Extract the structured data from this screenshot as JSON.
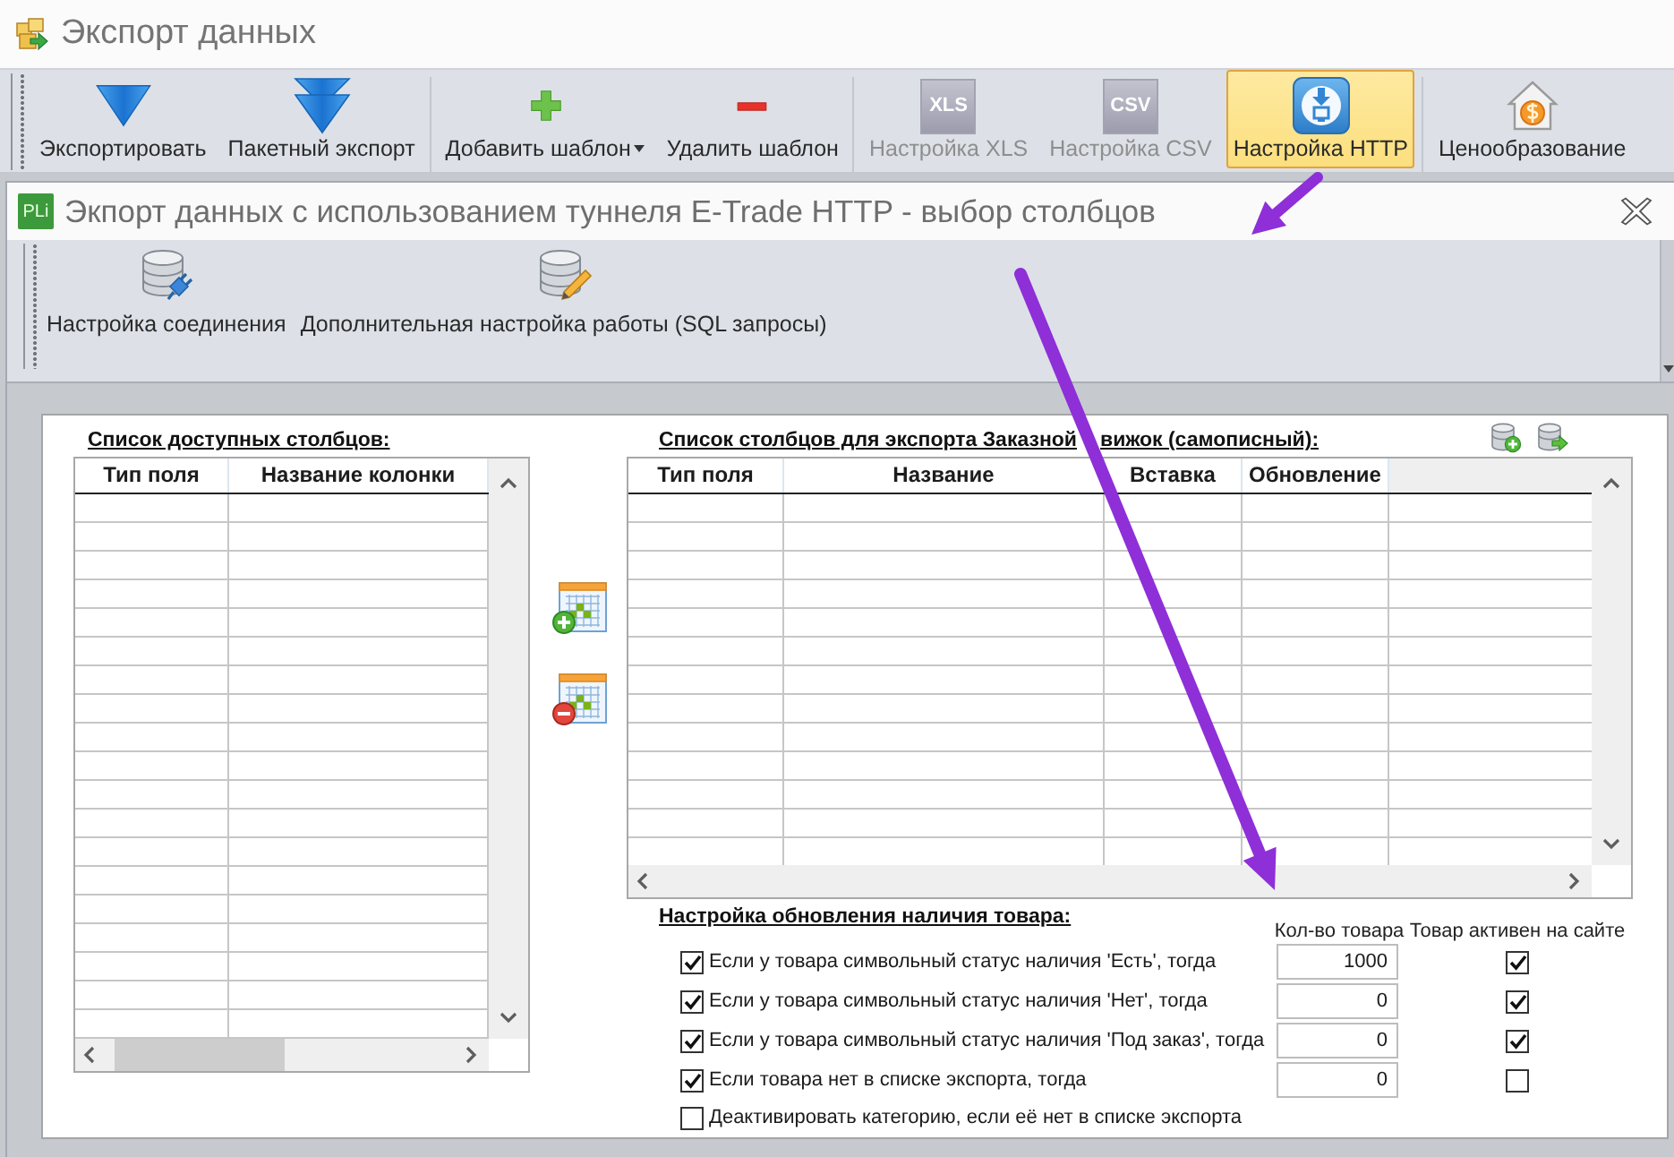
{
  "app": {
    "title": "Экспорт данных"
  },
  "ribbon": {
    "groups": [
      {
        "buttons": [
          {
            "label": "Экспортировать",
            "kind": "export",
            "selected": false,
            "disabled": false,
            "dropdown": false
          },
          {
            "label": "Пакетный экспорт",
            "kind": "batch-export",
            "selected": false,
            "disabled": false,
            "dropdown": false
          }
        ]
      },
      {
        "buttons": [
          {
            "label": "Добавить шаблон",
            "kind": "add",
            "selected": false,
            "disabled": false,
            "dropdown": true
          },
          {
            "label": "Удалить шаблон",
            "kind": "remove",
            "selected": false,
            "disabled": false,
            "dropdown": false
          }
        ]
      },
      {
        "buttons": [
          {
            "label": "Настройка XLS",
            "kind": "tile",
            "tile_text": "XLS",
            "selected": false,
            "disabled": true,
            "dropdown": false
          },
          {
            "label": "Настройка CSV",
            "kind": "tile",
            "tile_text": "CSV",
            "selected": false,
            "disabled": true,
            "dropdown": false
          },
          {
            "label": "Настройка HTTP",
            "kind": "http",
            "selected": true,
            "disabled": false,
            "dropdown": false
          }
        ]
      },
      {
        "buttons": [
          {
            "label": "Ценообразование",
            "kind": "pricing",
            "selected": false,
            "disabled": false,
            "dropdown": false
          }
        ]
      }
    ]
  },
  "dialog": {
    "logo_text": "PLi",
    "title": "Экпорт данных с использованием туннеля E-Trade HTTP - выбор столбцов",
    "toolbar": [
      {
        "label": "Настройка соединения",
        "kind": "connection"
      },
      {
        "label": "Дополнительная настройка работы (SQL запросы)",
        "kind": "sql"
      }
    ]
  },
  "available_columns": {
    "title": "Список доступных столбцов:",
    "columns": [
      "Тип поля",
      "Название колонки"
    ]
  },
  "export_columns": {
    "title_parts": [
      "Список столбцов для экспорта Заказной",
      "вижок (самописный):"
    ],
    "columns": [
      "Тип поля",
      "Название",
      "Вставка",
      "Обновление"
    ]
  },
  "stock_update": {
    "title": "Настройка обновления наличия товара:",
    "column_headers": [
      "Кол-во товара",
      "Товар активен на сайте"
    ],
    "rules": [
      {
        "label": "Если у товара символьный статус наличия 'Есть', тогда",
        "checked": true,
        "quantity": "1000",
        "active": true
      },
      {
        "label": "Если у товара символьный статус наличия 'Нет', тогда",
        "checked": true,
        "quantity": "0",
        "active": true
      },
      {
        "label": "Если у товара символьный статус наличия 'Под заказ', тогда",
        "checked": true,
        "quantity": "0",
        "active": true
      },
      {
        "label": "Если товара нет в списке экспорта, тогда",
        "checked": true,
        "quantity": "0",
        "active": false
      }
    ],
    "deactivate_category": {
      "label": "Деактивировать категорию, если её нет в списке экспорта",
      "checked": false
    }
  }
}
